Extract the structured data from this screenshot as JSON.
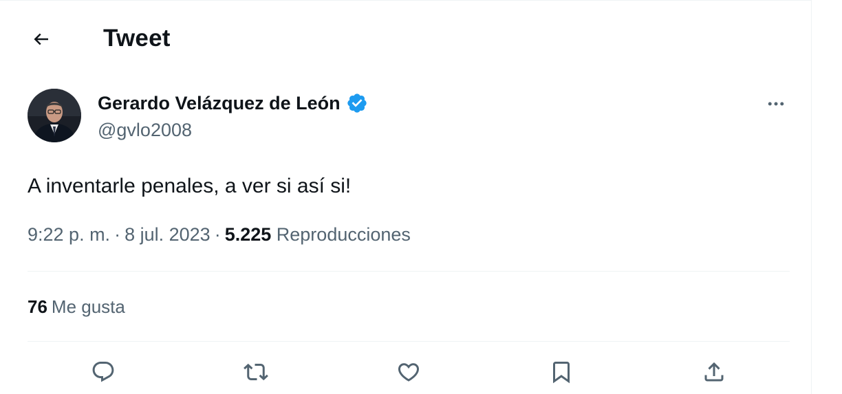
{
  "header": {
    "title": "Tweet"
  },
  "author": {
    "display_name": "Gerardo Velázquez de León",
    "handle": "@gvlo2008",
    "verified": true,
    "verified_color": "#1d9bf0"
  },
  "tweet": {
    "text": "A inventarle penales, a ver si así si!",
    "time": "9:22 p. m.",
    "date": "8 jul. 2023",
    "separator": "·",
    "views_count": "5.225",
    "views_label": "Reproducciones"
  },
  "stats": {
    "likes_count": "76",
    "likes_label": "Me gusta"
  },
  "actions": [
    {
      "name": "reply",
      "icon": "reply-icon"
    },
    {
      "name": "retweet",
      "icon": "retweet-icon"
    },
    {
      "name": "like",
      "icon": "heart-icon"
    },
    {
      "name": "bookmark",
      "icon": "bookmark-icon"
    },
    {
      "name": "share",
      "icon": "share-icon"
    }
  ],
  "colors": {
    "text_primary": "#0f1419",
    "text_secondary": "#536471",
    "divider": "#eff3f4",
    "accent": "#1d9bf0"
  }
}
